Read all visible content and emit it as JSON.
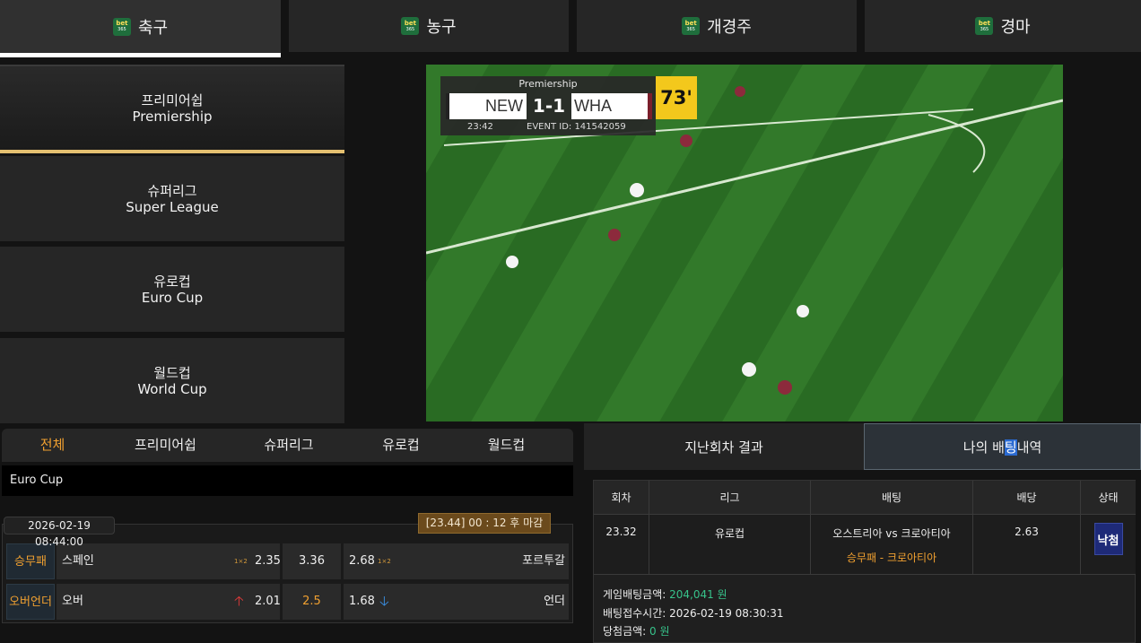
{
  "top_tabs": [
    {
      "label": "축구",
      "logo_top": "bet",
      "logo_bottom": "365"
    },
    {
      "label": "농구",
      "logo_top": "bet",
      "logo_bottom": "365"
    },
    {
      "label": "개경주",
      "logo_top": "bet",
      "logo_bottom": "365"
    },
    {
      "label": "경마",
      "logo_top": "bet",
      "logo_bottom": "365"
    }
  ],
  "leagues": [
    {
      "ko": "프리미어쉽",
      "en": "Premiership"
    },
    {
      "ko": "슈퍼리그",
      "en": "Super League"
    },
    {
      "ko": "유로컵",
      "en": "Euro Cup"
    },
    {
      "ko": "월드컵",
      "en": "World Cup"
    }
  ],
  "video": {
    "league": "Premiership",
    "home": "NEW",
    "score": "1-1",
    "away": "WHA",
    "clock": "23:42",
    "event_id": "EVENT ID:  141542059",
    "minute": "73'"
  },
  "filters": [
    "전체",
    "프리미어쉽",
    "슈퍼리그",
    "유로컵",
    "월드컵"
  ],
  "current_league": "Euro Cup",
  "match": {
    "date": "2026-02-19 08:44:00",
    "deadline": "[23.44] 00 : 12 후 마감",
    "row1": {
      "type": "승무패",
      "home_team": "스페인",
      "home_badge": "1×2",
      "home_odds": "2.35",
      "draw_odds": "3.36",
      "away_odds": "2.68",
      "away_badge": "1×2",
      "away_team": "포르투갈"
    },
    "row2": {
      "type": "오버언더",
      "over": "오버",
      "over_arrow": "🡡",
      "over_odds": "2.01",
      "line": "2.5",
      "under_odds": "1.68",
      "under_arrow": "🡣",
      "under": "언더"
    }
  },
  "right_tabs": {
    "past": "지난회차 결과",
    "mine_pre": "나의 배",
    "mine_hl": "팅",
    "mine_post": "내역"
  },
  "history": {
    "headers": [
      "회차",
      "리그",
      "배팅",
      "배당",
      "상태"
    ],
    "row": {
      "round": "23.32",
      "league": "유로컵",
      "bet_match": "오스트리아 vs 크로아티아",
      "bet_pick": "승무패 - 크로아티아",
      "odds": "2.63",
      "status": "낙첨"
    },
    "summary": {
      "amount_label": "게임배팅금액: ",
      "amount_value": "204,041 원",
      "time_label": "배팅접수시간: ",
      "time_value": "2026-02-19 08:30:31",
      "win_label": "당첨금액: ",
      "win_value": "0 원"
    }
  },
  "colors": {
    "accent_orange": "#f0a030",
    "active_border": "#e4c070",
    "win_green": "#37c28a",
    "status_blue": "#1e2a78"
  }
}
